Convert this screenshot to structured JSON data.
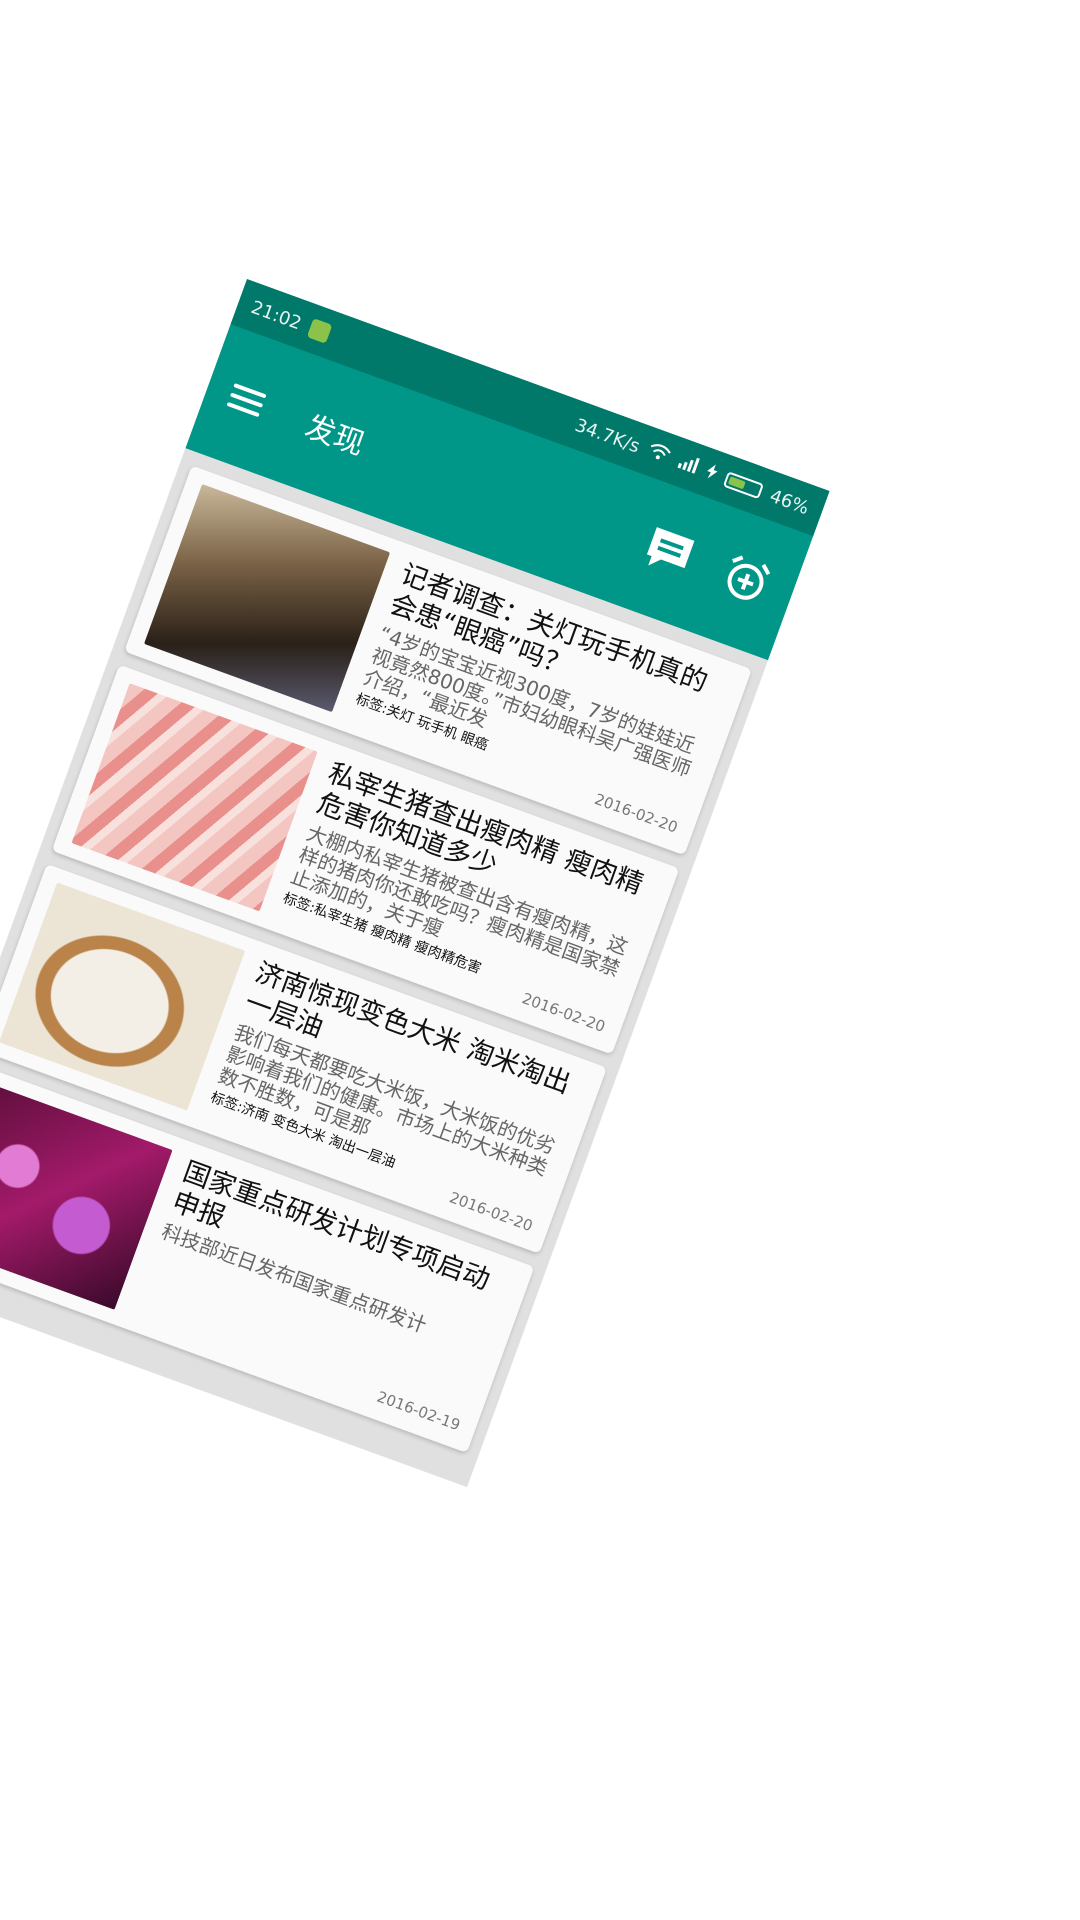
{
  "status_bar": {
    "time": "21:02",
    "network_speed": "34.7K/s",
    "battery_percent": "46%",
    "battery_level": 0.46,
    "icons": [
      "app-notification-icon",
      "wifi-icon",
      "signal-icon",
      "charging-icon",
      "battery-icon"
    ]
  },
  "toolbar": {
    "title": "发现",
    "menu_icon": "menu-icon",
    "actions": [
      "message-icon",
      "alarm-add-icon"
    ]
  },
  "articles": [
    {
      "title": "记者调查：关灯玩手机真的会患“眼癌”吗？",
      "summary": "“4岁的宝宝近视300度，7岁的娃娃近视竟然800度。”市妇幼眼科吴广强医师介绍，“最近发",
      "tags": "标签:关灯 玩手机 眼癌",
      "date": "2016-02-20"
    },
    {
      "title": "私宰生猪查出瘦肉精 瘦肉精危害你知道多少",
      "summary": "大棚内私宰生猪被查出含有瘦肉精，这样的猪肉你还敢吃吗？瘦肉精是国家禁止添加的，关于瘦",
      "tags": "标签:私宰生猪 瘦肉精 瘦肉精危害",
      "date": "2016-02-20"
    },
    {
      "title": "济南惊现变色大米 淘米淘出一层油",
      "summary": "我们每天都要吃大米饭，大米饭的优劣影响着我们的健康。市场上的大米种类数不胜数，可是那",
      "tags": "标签:济南 变色大米 淘出一层油",
      "date": "2016-02-20"
    },
    {
      "title": "国家重点研发计划专项启动申报",
      "summary": "科技部近日发布国家重点研发计",
      "tags": "",
      "date": "2016-02-19"
    }
  ]
}
